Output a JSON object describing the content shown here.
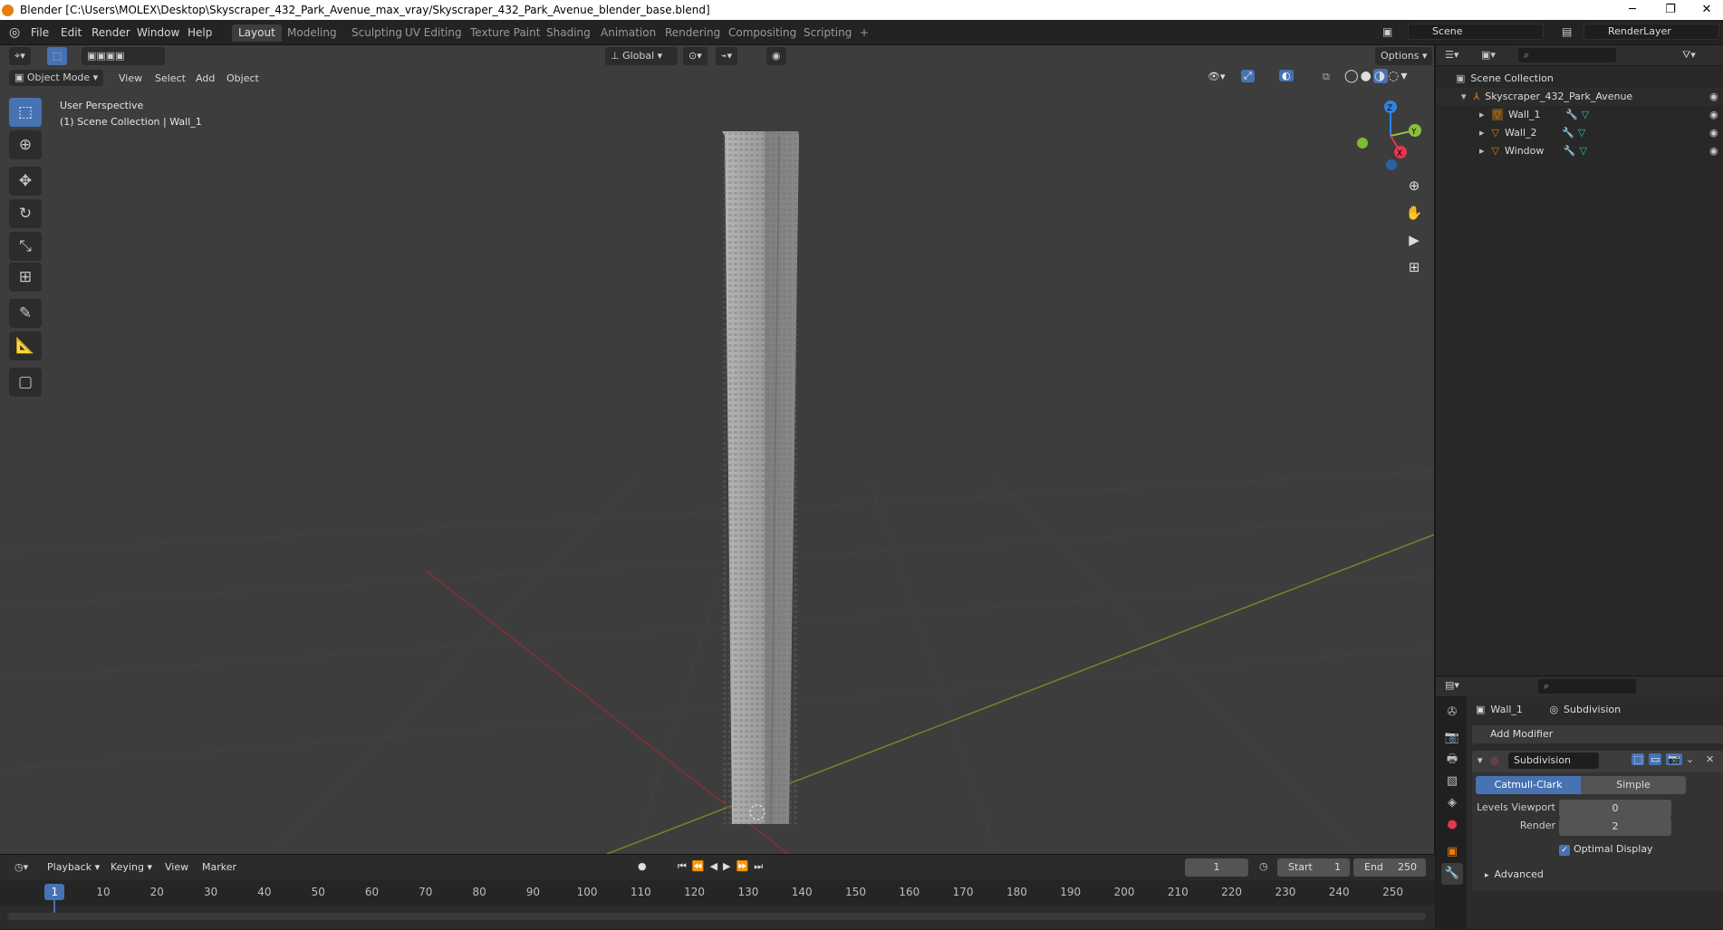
{
  "window": {
    "title": "Blender [C:\\Users\\MOLEX\\Desktop\\Skyscraper_432_Park_Avenue_max_vray/Skyscraper_432_Park_Avenue_blender_base.blend]",
    "minimize": "─",
    "restore": "❐",
    "close": "✕"
  },
  "menubar": {
    "items": [
      "File",
      "Edit",
      "Render",
      "Window",
      "Help"
    ],
    "workspaces": [
      "Layout",
      "Modeling",
      "Sculpting",
      "UV Editing",
      "Texture Paint",
      "Shading",
      "Animation",
      "Rendering",
      "Compositing",
      "Scripting"
    ],
    "add_tab": "+",
    "scene_label": "Scene",
    "render_layer_label": "RenderLayer"
  },
  "viewport": {
    "orientation": "Global",
    "options_label": "Options",
    "mode_label": "Object Mode",
    "menus": [
      "View",
      "Select",
      "Add",
      "Object"
    ],
    "perspective": "User Perspective",
    "collection_info": "(1) Scene Collection | Wall_1",
    "gizmo": {
      "z": "Z",
      "y": "Y",
      "x": "X"
    }
  },
  "outliner": {
    "root": "Scene Collection",
    "collection": "Skyscraper_432_Park_Avenue",
    "objects": [
      "Wall_1",
      "Wall_2",
      "Window"
    ]
  },
  "properties": {
    "object_name": "Wall_1",
    "modifier_name": "Subdivision",
    "add_modifier": "Add Modifier",
    "panel_name": "Subdivision",
    "method_active": "Catmull-Clark",
    "method_other": "Simple",
    "levels_viewport_label": "Levels Viewport",
    "levels_viewport_value": "0",
    "render_label": "Render",
    "render_value": "2",
    "optimal_display": "Optimal Display",
    "advanced": "Advanced"
  },
  "timeline": {
    "menus": [
      "Playback",
      "Keying",
      "View",
      "Marker"
    ],
    "current_frame": "1",
    "start_label": "Start",
    "start_value": "1",
    "end_label": "End",
    "end_value": "250",
    "ticks": [
      "1",
      "10",
      "20",
      "30",
      "40",
      "50",
      "60",
      "70",
      "80",
      "90",
      "100",
      "110",
      "120",
      "130",
      "140",
      "150",
      "160",
      "170",
      "180",
      "190",
      "200",
      "210",
      "220",
      "230",
      "240",
      "250"
    ]
  },
  "colors": {
    "accent": "#4772b3",
    "x_axis": "#e2364f",
    "y_axis": "#8bc13a",
    "z_axis": "#2f84e3",
    "object_orange": "#e87d0d"
  }
}
